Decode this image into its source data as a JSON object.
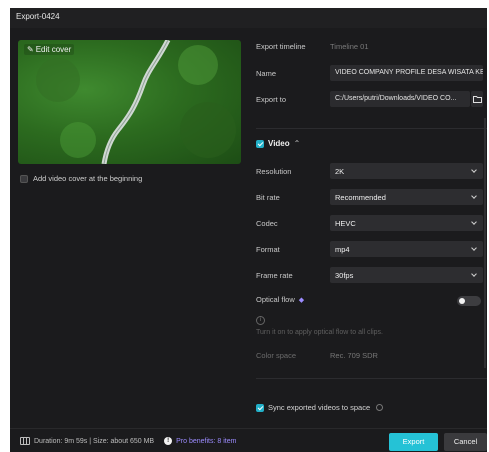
{
  "window": {
    "title": "Export-0424"
  },
  "left": {
    "edit_cover": "Edit cover",
    "add_cover_label": "Add video cover at the beginning",
    "add_cover_checked": false
  },
  "fields": {
    "export_timeline_label": "Export timeline",
    "export_timeline_value": "Timeline 01",
    "name_label": "Name",
    "name_value": "VIDEO COMPANY PROFILE DESA WISATA KE",
    "export_to_label": "Export to",
    "export_to_value": "C:/Users/putri/Downloads/VIDEO CO..."
  },
  "video": {
    "label": "Video",
    "caret": "⌃",
    "checked": true,
    "resolution_label": "Resolution",
    "resolution_value": "2K",
    "bitrate_label": "Bit rate",
    "bitrate_value": "Recommended",
    "codec_label": "Codec",
    "codec_value": "HEVC",
    "format_label": "Format",
    "format_value": "mp4",
    "framerate_label": "Frame rate",
    "framerate_value": "30fps",
    "optical_flow_label": "Optical flow",
    "optical_flow_on": false,
    "optical_flow_hint": "Turn it on to apply optical flow to all clips.",
    "color_space_label": "Color space",
    "color_space_value": "Rec. 709 SDR"
  },
  "sync": {
    "label": "Sync exported videos to space",
    "checked": true
  },
  "footer": {
    "info": "Duration: 9m 59s | Size: about 650 MB",
    "pro_benefits": "Pro benefits: 8 item",
    "export_label": "Export",
    "cancel_label": "Cancel"
  },
  "colors": {
    "accent": "#25c2d6",
    "pro": "#9c8cff",
    "background": "#1b1b1d"
  }
}
